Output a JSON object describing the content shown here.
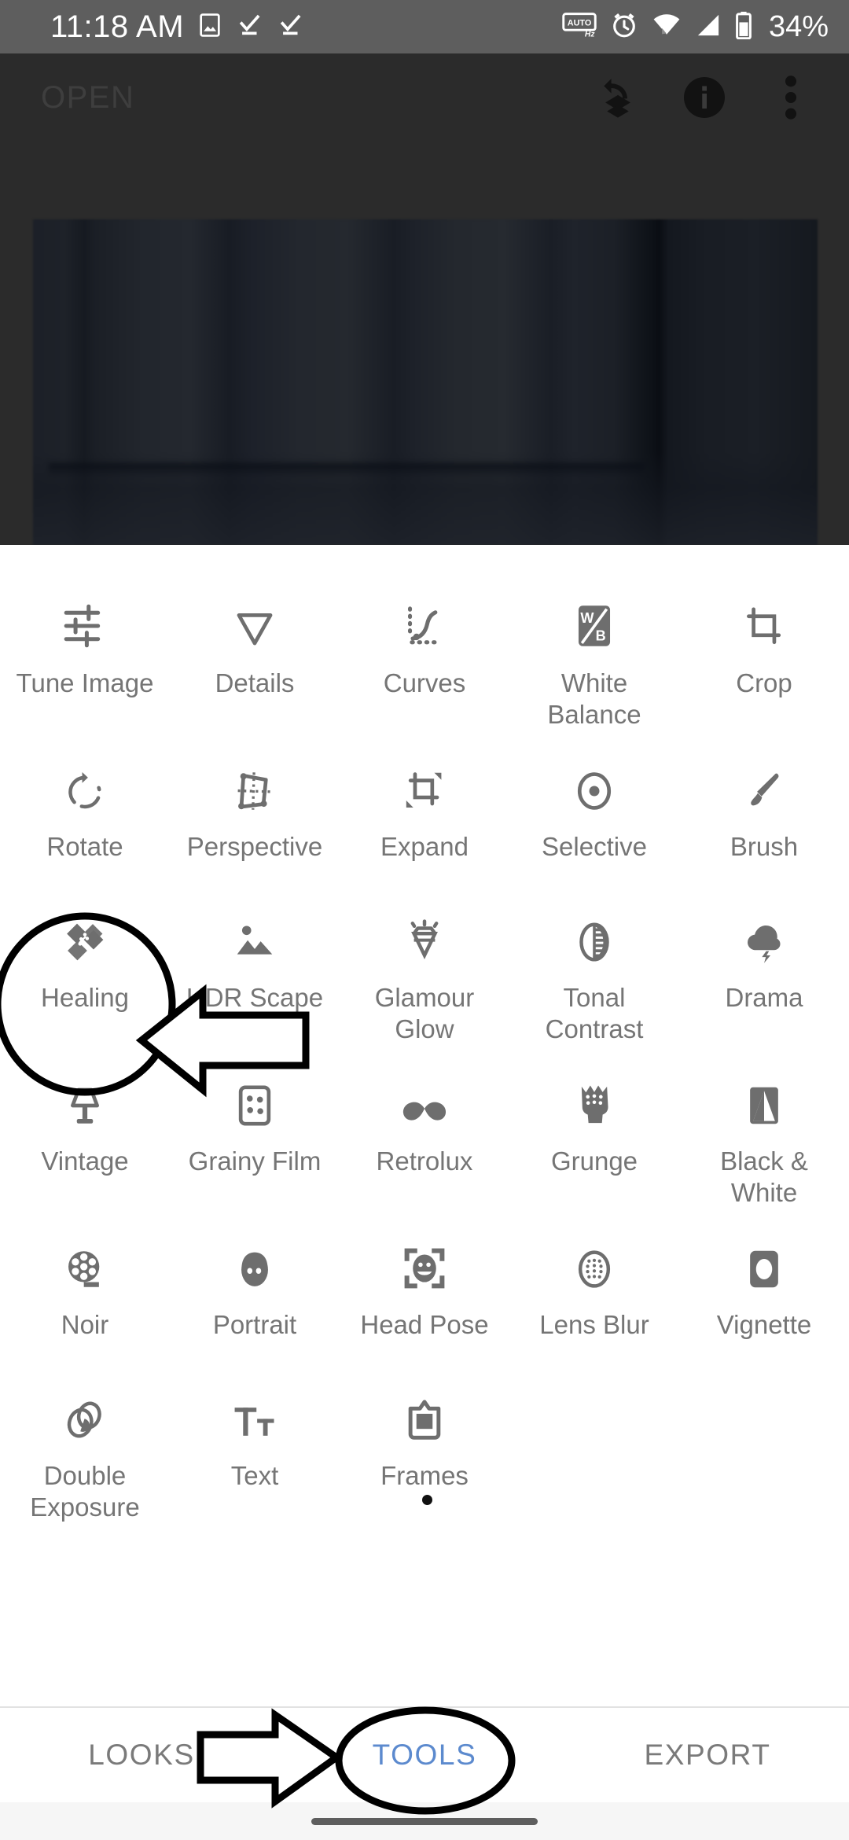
{
  "status_bar": {
    "time": "11:18 AM",
    "battery_percent": "34%",
    "icons": [
      "image-icon",
      "task-complete-icon",
      "task-complete-icon",
      "auto-hz-icon",
      "alarm-icon",
      "wifi-icon",
      "cellular-signal-icon",
      "battery-icon"
    ]
  },
  "app_bar": {
    "title": "OPEN",
    "actions": [
      {
        "name": "undo-stack-icon",
        "label": "Undo"
      },
      {
        "name": "info-icon",
        "label": "Info"
      },
      {
        "name": "overflow-menu-icon",
        "label": "More options"
      }
    ]
  },
  "preview": {
    "description": "dark blurred photo of a room with vertical blinds"
  },
  "tools": {
    "rows": [
      [
        {
          "label": "Tune Image",
          "icon": "sliders-icon"
        },
        {
          "label": "Details",
          "icon": "triangle-down-icon"
        },
        {
          "label": "Curves",
          "icon": "curves-icon"
        },
        {
          "label": "White Balance",
          "icon": "white-balance-icon"
        },
        {
          "label": "Crop",
          "icon": "crop-icon"
        }
      ],
      [
        {
          "label": "Rotate",
          "icon": "rotate-icon"
        },
        {
          "label": "Perspective",
          "icon": "perspective-icon"
        },
        {
          "label": "Expand",
          "icon": "expand-icon"
        },
        {
          "label": "Selective",
          "icon": "selective-icon"
        },
        {
          "label": "Brush",
          "icon": "brush-icon"
        }
      ],
      [
        {
          "label": "Healing",
          "icon": "healing-bandage-icon"
        },
        {
          "label": "HDR Scape",
          "icon": "hdr-scape-icon"
        },
        {
          "label": "Glamour Glow",
          "icon": "glamour-glow-icon"
        },
        {
          "label": "Tonal Contrast",
          "icon": "tonal-contrast-icon"
        },
        {
          "label": "Drama",
          "icon": "drama-cloud-icon"
        }
      ],
      [
        {
          "label": "Vintage",
          "icon": "lamp-icon"
        },
        {
          "label": "Grainy Film",
          "icon": "grainy-film-icon"
        },
        {
          "label": "Retrolux",
          "icon": "mustache-icon"
        },
        {
          "label": "Grunge",
          "icon": "grunge-icon"
        },
        {
          "label": "Black & White",
          "icon": "black-white-icon"
        }
      ],
      [
        {
          "label": "Noir",
          "icon": "film-reel-icon"
        },
        {
          "label": "Portrait",
          "icon": "portrait-face-icon"
        },
        {
          "label": "Head Pose",
          "icon": "head-pose-icon"
        },
        {
          "label": "Lens Blur",
          "icon": "lens-blur-icon"
        },
        {
          "label": "Vignette",
          "icon": "vignette-icon"
        }
      ],
      [
        {
          "label": "Double Exposure",
          "icon": "double-exposure-icon"
        },
        {
          "label": "Text",
          "icon": "text-icon"
        },
        {
          "label": "Frames",
          "icon": "frames-icon"
        }
      ]
    ]
  },
  "bottom_nav": {
    "items": [
      {
        "label": "LOOKS",
        "active": false
      },
      {
        "label": "TOOLS",
        "active": true
      },
      {
        "label": "EXPORT",
        "active": false
      }
    ]
  },
  "annotations": {
    "healing_highlight": "circle around Healing tool",
    "healing_arrow": "left-pointing arrow to Healing tool",
    "tools_highlight": "ellipse around TOOLS tab",
    "tools_arrow": "right-pointing arrow to TOOLS tab"
  },
  "colors": {
    "status_bar_bg": "#5e5e5e",
    "app_bar_bg": "#2b2b2b",
    "panel_bg": "#ffffff",
    "tool_label": "#757575",
    "tool_icon": "#6e6e6e",
    "accent_blue": "#5c8ace",
    "annotation": "#000000"
  }
}
